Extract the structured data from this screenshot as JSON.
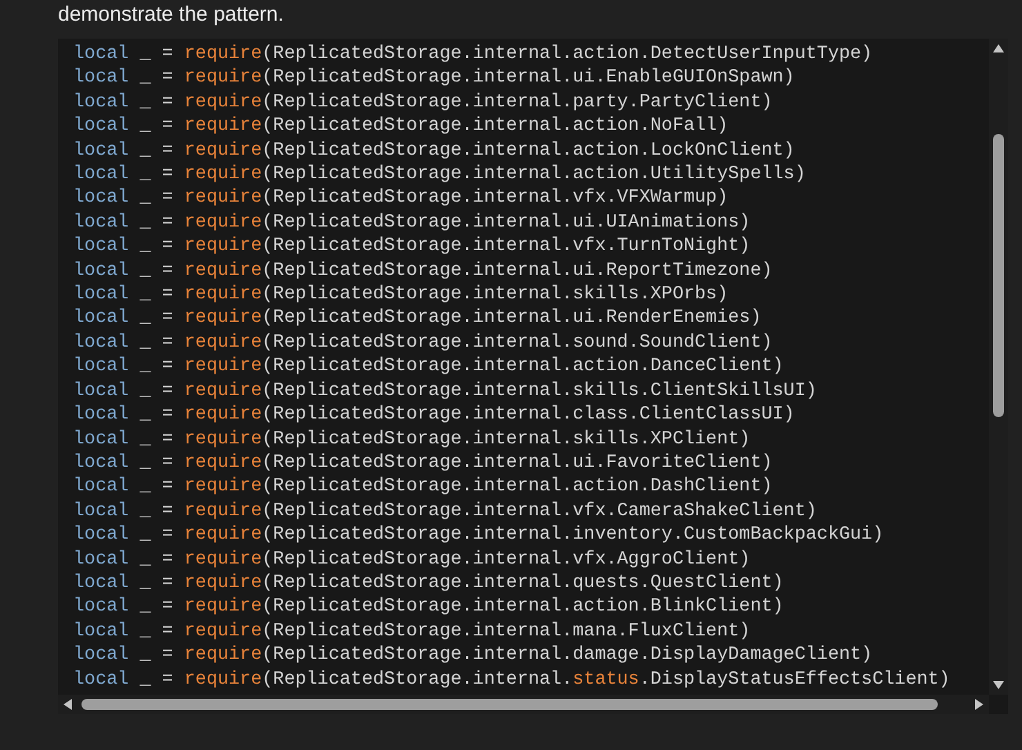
{
  "intro": "demonstrate the pattern.",
  "code_lines": [
    {
      "tokens": [
        {
          "kind": "keyword",
          "text": "local"
        },
        {
          "kind": "plain",
          "text": " _ = "
        },
        {
          "kind": "builtin",
          "text": "require"
        },
        {
          "kind": "plain",
          "text": "(ReplicatedStorage.internal.action.DetectUserInputType)"
        }
      ]
    },
    {
      "tokens": [
        {
          "kind": "keyword",
          "text": "local"
        },
        {
          "kind": "plain",
          "text": " _ = "
        },
        {
          "kind": "builtin",
          "text": "require"
        },
        {
          "kind": "plain",
          "text": "(ReplicatedStorage.internal.ui.EnableGUIOnSpawn)"
        }
      ]
    },
    {
      "tokens": [
        {
          "kind": "keyword",
          "text": "local"
        },
        {
          "kind": "plain",
          "text": " _ = "
        },
        {
          "kind": "builtin",
          "text": "require"
        },
        {
          "kind": "plain",
          "text": "(ReplicatedStorage.internal.party.PartyClient)"
        }
      ]
    },
    {
      "tokens": [
        {
          "kind": "keyword",
          "text": "local"
        },
        {
          "kind": "plain",
          "text": " _ = "
        },
        {
          "kind": "builtin",
          "text": "require"
        },
        {
          "kind": "plain",
          "text": "(ReplicatedStorage.internal.action.NoFall)"
        }
      ]
    },
    {
      "tokens": [
        {
          "kind": "keyword",
          "text": "local"
        },
        {
          "kind": "plain",
          "text": " _ = "
        },
        {
          "kind": "builtin",
          "text": "require"
        },
        {
          "kind": "plain",
          "text": "(ReplicatedStorage.internal.action.LockOnClient)"
        }
      ]
    },
    {
      "tokens": [
        {
          "kind": "keyword",
          "text": "local"
        },
        {
          "kind": "plain",
          "text": " _ = "
        },
        {
          "kind": "builtin",
          "text": "require"
        },
        {
          "kind": "plain",
          "text": "(ReplicatedStorage.internal.action.UtilitySpells)"
        }
      ]
    },
    {
      "tokens": [
        {
          "kind": "keyword",
          "text": "local"
        },
        {
          "kind": "plain",
          "text": " _ = "
        },
        {
          "kind": "builtin",
          "text": "require"
        },
        {
          "kind": "plain",
          "text": "(ReplicatedStorage.internal.vfx.VFXWarmup)"
        }
      ]
    },
    {
      "tokens": [
        {
          "kind": "keyword",
          "text": "local"
        },
        {
          "kind": "plain",
          "text": " _ = "
        },
        {
          "kind": "builtin",
          "text": "require"
        },
        {
          "kind": "plain",
          "text": "(ReplicatedStorage.internal.ui.UIAnimations)"
        }
      ]
    },
    {
      "tokens": [
        {
          "kind": "keyword",
          "text": "local"
        },
        {
          "kind": "plain",
          "text": " _ = "
        },
        {
          "kind": "builtin",
          "text": "require"
        },
        {
          "kind": "plain",
          "text": "(ReplicatedStorage.internal.vfx.TurnToNight)"
        }
      ]
    },
    {
      "tokens": [
        {
          "kind": "keyword",
          "text": "local"
        },
        {
          "kind": "plain",
          "text": " _ = "
        },
        {
          "kind": "builtin",
          "text": "require"
        },
        {
          "kind": "plain",
          "text": "(ReplicatedStorage.internal.ui.ReportTimezone)"
        }
      ]
    },
    {
      "tokens": [
        {
          "kind": "keyword",
          "text": "local"
        },
        {
          "kind": "plain",
          "text": " _ = "
        },
        {
          "kind": "builtin",
          "text": "require"
        },
        {
          "kind": "plain",
          "text": "(ReplicatedStorage.internal.skills.XPOrbs)"
        }
      ]
    },
    {
      "tokens": [
        {
          "kind": "keyword",
          "text": "local"
        },
        {
          "kind": "plain",
          "text": " _ = "
        },
        {
          "kind": "builtin",
          "text": "require"
        },
        {
          "kind": "plain",
          "text": "(ReplicatedStorage.internal.ui.RenderEnemies)"
        }
      ]
    },
    {
      "tokens": [
        {
          "kind": "keyword",
          "text": "local"
        },
        {
          "kind": "plain",
          "text": " _ = "
        },
        {
          "kind": "builtin",
          "text": "require"
        },
        {
          "kind": "plain",
          "text": "(ReplicatedStorage.internal.sound.SoundClient)"
        }
      ]
    },
    {
      "tokens": [
        {
          "kind": "keyword",
          "text": "local"
        },
        {
          "kind": "plain",
          "text": " _ = "
        },
        {
          "kind": "builtin",
          "text": "require"
        },
        {
          "kind": "plain",
          "text": "(ReplicatedStorage.internal.action.DanceClient)"
        }
      ]
    },
    {
      "tokens": [
        {
          "kind": "keyword",
          "text": "local"
        },
        {
          "kind": "plain",
          "text": " _ = "
        },
        {
          "kind": "builtin",
          "text": "require"
        },
        {
          "kind": "plain",
          "text": "(ReplicatedStorage.internal.skills.ClientSkillsUI)"
        }
      ]
    },
    {
      "tokens": [
        {
          "kind": "keyword",
          "text": "local"
        },
        {
          "kind": "plain",
          "text": " _ = "
        },
        {
          "kind": "builtin",
          "text": "require"
        },
        {
          "kind": "plain",
          "text": "(ReplicatedStorage.internal.class.ClientClassUI)"
        }
      ]
    },
    {
      "tokens": [
        {
          "kind": "keyword",
          "text": "local"
        },
        {
          "kind": "plain",
          "text": " _ = "
        },
        {
          "kind": "builtin",
          "text": "require"
        },
        {
          "kind": "plain",
          "text": "(ReplicatedStorage.internal.skills.XPClient)"
        }
      ]
    },
    {
      "tokens": [
        {
          "kind": "keyword",
          "text": "local"
        },
        {
          "kind": "plain",
          "text": " _ = "
        },
        {
          "kind": "builtin",
          "text": "require"
        },
        {
          "kind": "plain",
          "text": "(ReplicatedStorage.internal.ui.FavoriteClient)"
        }
      ]
    },
    {
      "tokens": [
        {
          "kind": "keyword",
          "text": "local"
        },
        {
          "kind": "plain",
          "text": " _ = "
        },
        {
          "kind": "builtin",
          "text": "require"
        },
        {
          "kind": "plain",
          "text": "(ReplicatedStorage.internal.action.DashClient)"
        }
      ]
    },
    {
      "tokens": [
        {
          "kind": "keyword",
          "text": "local"
        },
        {
          "kind": "plain",
          "text": " _ = "
        },
        {
          "kind": "builtin",
          "text": "require"
        },
        {
          "kind": "plain",
          "text": "(ReplicatedStorage.internal.vfx.CameraShakeClient)"
        }
      ]
    },
    {
      "tokens": [
        {
          "kind": "keyword",
          "text": "local"
        },
        {
          "kind": "plain",
          "text": " _ = "
        },
        {
          "kind": "builtin",
          "text": "require"
        },
        {
          "kind": "plain",
          "text": "(ReplicatedStorage.internal.inventory.CustomBackpackGui)"
        }
      ]
    },
    {
      "tokens": [
        {
          "kind": "keyword",
          "text": "local"
        },
        {
          "kind": "plain",
          "text": " _ = "
        },
        {
          "kind": "builtin",
          "text": "require"
        },
        {
          "kind": "plain",
          "text": "(ReplicatedStorage.internal.vfx.AggroClient)"
        }
      ]
    },
    {
      "tokens": [
        {
          "kind": "keyword",
          "text": "local"
        },
        {
          "kind": "plain",
          "text": " _ = "
        },
        {
          "kind": "builtin",
          "text": "require"
        },
        {
          "kind": "plain",
          "text": "(ReplicatedStorage.internal.quests.QuestClient)"
        }
      ]
    },
    {
      "tokens": [
        {
          "kind": "keyword",
          "text": "local"
        },
        {
          "kind": "plain",
          "text": " _ = "
        },
        {
          "kind": "builtin",
          "text": "require"
        },
        {
          "kind": "plain",
          "text": "(ReplicatedStorage.internal.action.BlinkClient)"
        }
      ]
    },
    {
      "tokens": [
        {
          "kind": "keyword",
          "text": "local"
        },
        {
          "kind": "plain",
          "text": " _ = "
        },
        {
          "kind": "builtin",
          "text": "require"
        },
        {
          "kind": "plain",
          "text": "(ReplicatedStorage.internal.mana.FluxClient)"
        }
      ]
    },
    {
      "tokens": [
        {
          "kind": "keyword",
          "text": "local"
        },
        {
          "kind": "plain",
          "text": " _ = "
        },
        {
          "kind": "builtin",
          "text": "require"
        },
        {
          "kind": "plain",
          "text": "(ReplicatedStorage.internal.damage.DisplayDamageClient)"
        }
      ]
    },
    {
      "tokens": [
        {
          "kind": "keyword",
          "text": "local"
        },
        {
          "kind": "plain",
          "text": " _ = "
        },
        {
          "kind": "builtin",
          "text": "require"
        },
        {
          "kind": "plain",
          "text": "(ReplicatedStorage.internal."
        },
        {
          "kind": "builtin",
          "text": "status"
        },
        {
          "kind": "plain",
          "text": ".DisplayStatusEffectsClient)"
        }
      ]
    }
  ]
}
